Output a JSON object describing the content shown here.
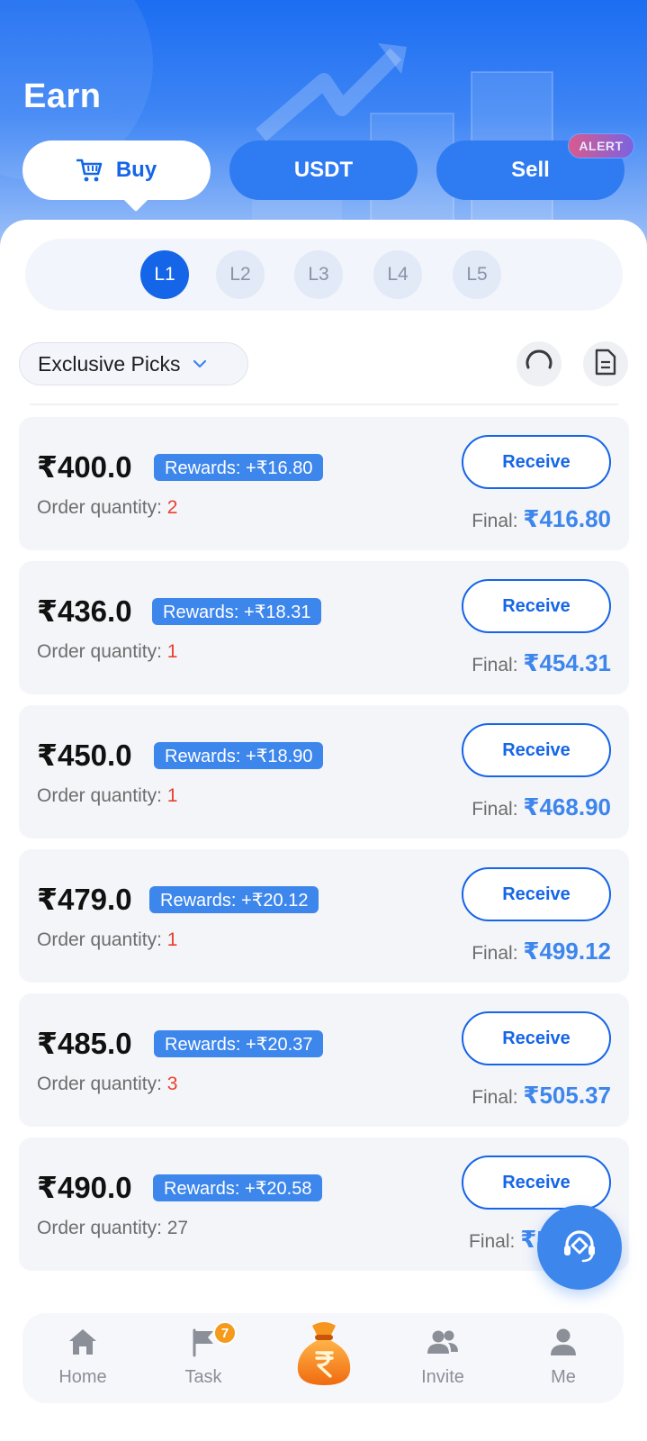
{
  "header": {
    "title": "Earn",
    "tabs": [
      {
        "label": "Buy",
        "active": true
      },
      {
        "label": "USDT",
        "active": false
      },
      {
        "label": "Sell",
        "active": false
      }
    ],
    "alert_badge": "ALERT"
  },
  "levels": [
    {
      "label": "L1",
      "active": true
    },
    {
      "label": "L2",
      "active": false
    },
    {
      "label": "L3",
      "active": false
    },
    {
      "label": "L4",
      "active": false
    },
    {
      "label": "L5",
      "active": false
    }
  ],
  "filter": {
    "selected": "Exclusive Picks",
    "icon": "chevron-down-icon"
  },
  "toolbar_icons": [
    "refresh-icon",
    "document-icon"
  ],
  "orders": {
    "quantity_label": "Order quantity: ",
    "final_label": "Final: ",
    "receive_label": "Receive",
    "items": [
      {
        "amount": "₹400.0",
        "reward": "Rewards: +₹16.80",
        "quantity": "2",
        "final": "₹416.80"
      },
      {
        "amount": "₹436.0",
        "reward": "Rewards: +₹18.31",
        "quantity": "1",
        "final": "₹454.31"
      },
      {
        "amount": "₹450.0",
        "reward": "Rewards: +₹18.90",
        "quantity": "1",
        "final": "₹468.90"
      },
      {
        "amount": "₹479.0",
        "reward": "Rewards: +₹20.12",
        "quantity": "1",
        "final": "₹499.12"
      },
      {
        "amount": "₹485.0",
        "reward": "Rewards: +₹20.37",
        "quantity": "3",
        "final": "₹505.37"
      },
      {
        "amount": "₹490.0",
        "reward": "Rewards: +₹20.58",
        "quantity": "27",
        "final": "₹5"
      }
    ]
  },
  "nav": {
    "items": [
      {
        "label": "Home",
        "icon": "home-icon"
      },
      {
        "label": "Task",
        "icon": "flag-icon",
        "badge": "7"
      },
      {
        "label": "",
        "icon": "money-bag-icon"
      },
      {
        "label": "Invite",
        "icon": "users-icon"
      },
      {
        "label": "Me",
        "icon": "person-icon"
      }
    ]
  },
  "colors": {
    "primary": "#1565e8",
    "accent": "#3d86ec",
    "quantity_highlight": "#e8412f",
    "task_badge": "#f59a1a"
  }
}
